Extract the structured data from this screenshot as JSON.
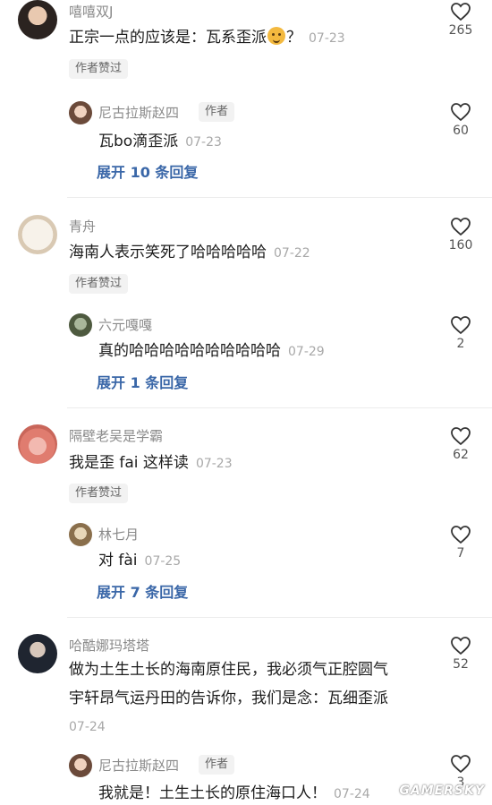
{
  "heart_icon": "heart-outline-icon",
  "threads": [
    {
      "author": "嘻嘻双J",
      "text": "正宗一点的应该是：瓦系歪派",
      "text_suffix": "？",
      "emoji": "face-emoji",
      "time": "07-23",
      "likes": "265",
      "badge": "作者赞过",
      "reply": {
        "author": "尼古拉斯赵四",
        "author_tag": "作者",
        "text": "瓦bo滴歪派",
        "time": "07-23",
        "likes": "60"
      },
      "expand": "展开 10 条回复"
    },
    {
      "author": "青舟",
      "text": "海南人表示笑死了哈哈哈哈哈",
      "time": "07-22",
      "likes": "160",
      "badge": "作者赞过",
      "reply": {
        "author": "六元嘎嘎",
        "text": "真的哈哈哈哈哈哈哈哈哈哈",
        "time": "07-29",
        "likes": "2"
      },
      "expand": "展开 1 条回复"
    },
    {
      "author": "隔壁老吴是学霸",
      "text": "我是歪 fai 这样读",
      "time": "07-23",
      "likes": "62",
      "badge": "作者赞过",
      "reply": {
        "author": "林七月",
        "text": "对 fài",
        "time": "07-25",
        "likes": "7"
      },
      "expand": "展开 7 条回复"
    },
    {
      "author": "哈酷娜玛塔塔",
      "line1": "做为土生土长的海南原住民，我必须气正腔圆气",
      "line2": "宇轩昂气运丹田的告诉你，我们是念：瓦细歪派",
      "time": "07-24",
      "likes": "52",
      "reply": {
        "author": "尼古拉斯赵四",
        "author_tag": "作者",
        "text": "我就是！土生土长的原住海口人！",
        "time": "07-24",
        "likes": "3"
      }
    }
  ],
  "watermark": "GAMERSKY"
}
